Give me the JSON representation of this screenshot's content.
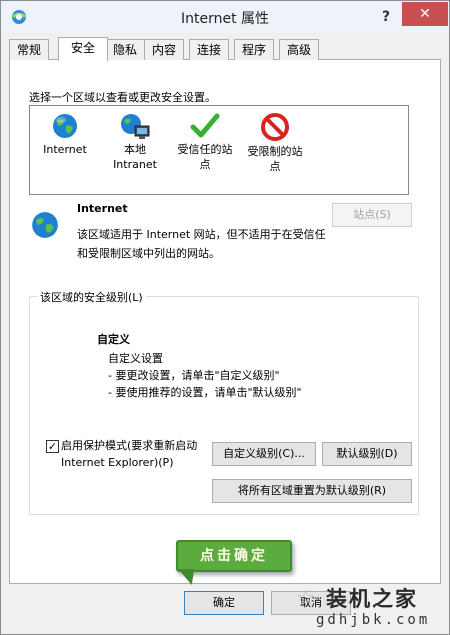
{
  "window": {
    "title": "Internet 属性",
    "help_label": "?",
    "close_label": "✕"
  },
  "tabs": [
    {
      "label": "常规"
    },
    {
      "label": "安全"
    },
    {
      "label": "隐私"
    },
    {
      "label": "内容"
    },
    {
      "label": "连接"
    },
    {
      "label": "程序"
    },
    {
      "label": "高级"
    }
  ],
  "active_tab": "安全",
  "zones": {
    "prompt": "选择一个区域以查看或更改安全设置。",
    "items": [
      {
        "label": "Internet",
        "icon": "globe-icon"
      },
      {
        "label": "本地\nIntranet",
        "icon": "intranet-icon"
      },
      {
        "label": "受信任的站\n点",
        "icon": "checkmark-icon"
      },
      {
        "label": "受限制的站\n点",
        "icon": "restricted-icon"
      }
    ]
  },
  "selected_zone": {
    "name": "Internet",
    "description": "该区域适用于 Internet 网站，但不适用于在受信任和受限制区域中列出的网站。",
    "sites_button": "站点(S)"
  },
  "security_level": {
    "group_label": "该区域的安全级别(L)",
    "level_name": "自定义",
    "desc_lines": [
      "自定义设置",
      "- 要更改设置，请单击\"自定义级别\"",
      "- 要使用推荐的设置，请单击\"默认级别\""
    ],
    "protected_mode_label": "启用保护模式(要求重新启动\nInternet Explorer)(P)",
    "protected_mode_checked": true,
    "custom_level_button": "自定义级别(C)...",
    "default_level_button": "默认级别(D)",
    "reset_all_button": "将所有区域重置为默认级别(R)"
  },
  "footer": {
    "ok_button": "确定",
    "cancel_button": "取消"
  },
  "callout": {
    "text": "点击确定"
  },
  "watermark": {
    "title": "装机之家",
    "url": "gdhjbk.com",
    "star": "☆"
  },
  "colors": {
    "callout_bg": "#5bab3e",
    "close_bg": "#c75050",
    "accent": "#3c7fb1"
  }
}
